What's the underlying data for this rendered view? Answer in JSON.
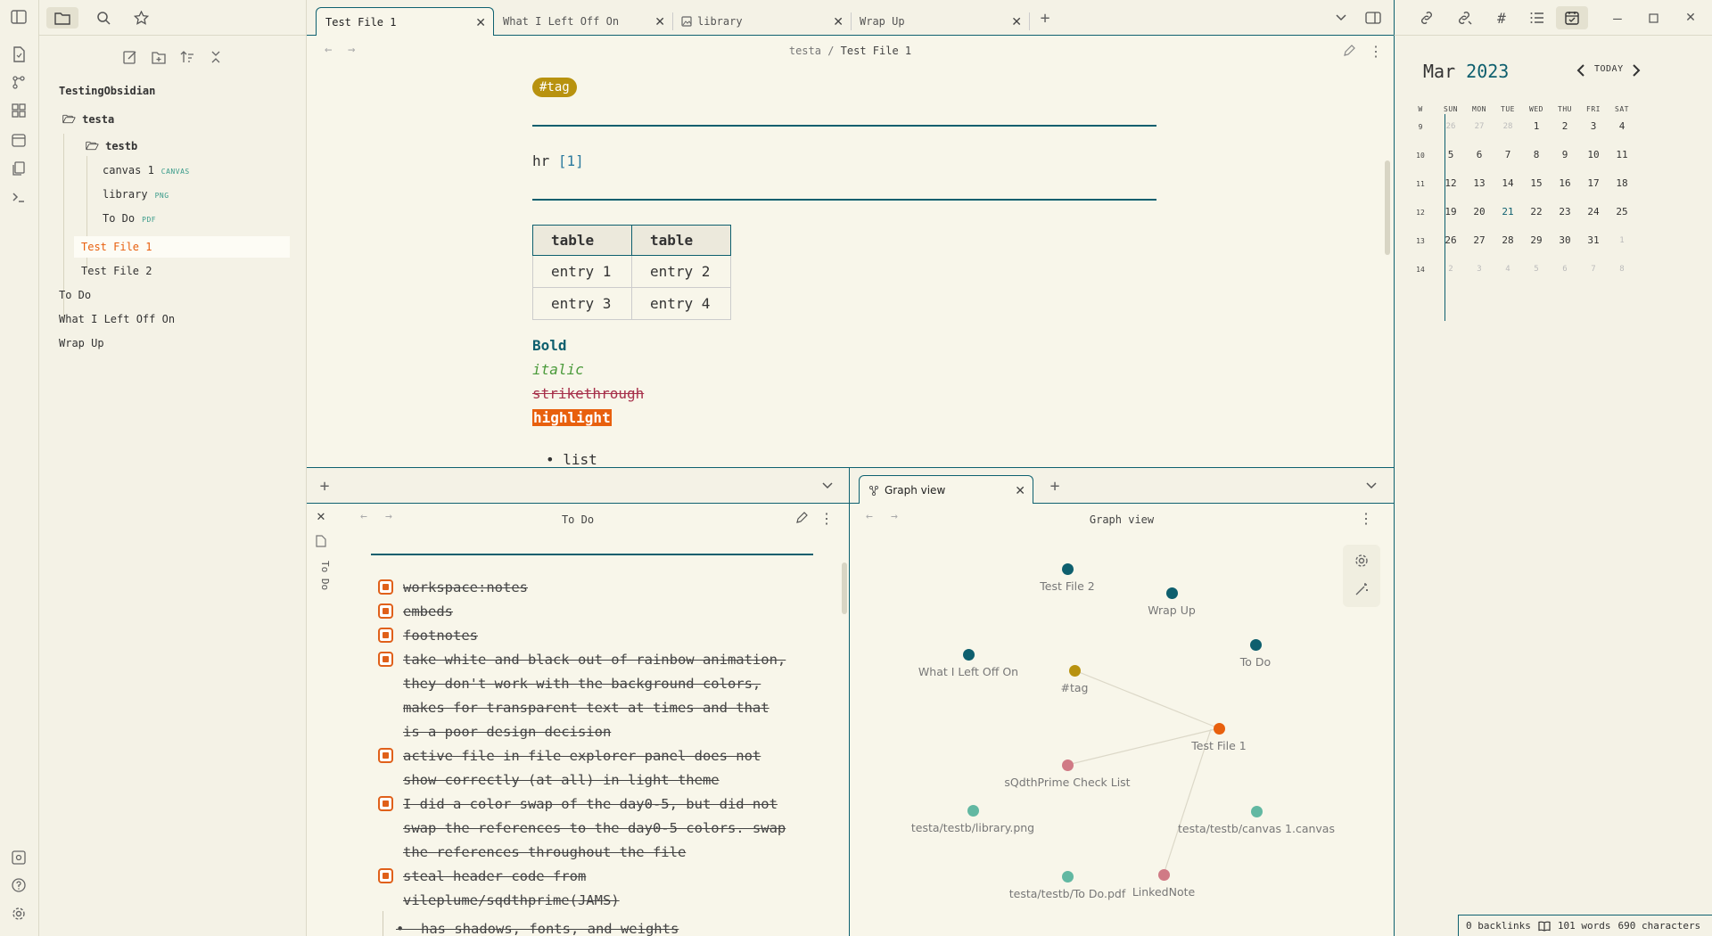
{
  "left_tabs": {
    "files": "Files",
    "search": "Search",
    "bookmarks": "Bookmarks"
  },
  "file_tree": {
    "vault": "TestingObsidian",
    "folder_a": "testa",
    "folder_b": "testb",
    "items": [
      {
        "name": "canvas 1",
        "ext": "CANVAS"
      },
      {
        "name": "library",
        "ext": "PNG"
      },
      {
        "name": "To Do",
        "ext": "PDF"
      }
    ],
    "test1": "Test File 1",
    "test2": "Test File 2",
    "root": [
      "To Do",
      "What I Left Off On",
      "Wrap Up"
    ]
  },
  "tabs": [
    "Test File 1",
    "What I Left Off On",
    "library",
    "Wrap Up"
  ],
  "editor": {
    "breadcrumb_folder": "testa",
    "breadcrumb_sep": "/",
    "breadcrumb_file": "Test File 1",
    "tag": "#tag",
    "hr_text": "hr",
    "footnote": "[1]",
    "table": {
      "headers": [
        "table",
        "table"
      ],
      "rows": [
        [
          "entry 1",
          "entry 2"
        ],
        [
          "entry 3",
          "entry 4"
        ]
      ]
    },
    "bold": "Bold",
    "italic": "italic",
    "strike": "strikethrough",
    "highlight": "highlight",
    "list_item": "list"
  },
  "calendar": {
    "month": "Mar",
    "year": "2023",
    "today_label": "TODAY",
    "headers": [
      "W",
      "SUN",
      "MON",
      "TUE",
      "WED",
      "THU",
      "FRI",
      "SAT"
    ],
    "rows": [
      [
        "9",
        "26",
        "27",
        "28",
        "1",
        "2",
        "3",
        "4"
      ],
      [
        "10",
        "5",
        "6",
        "7",
        "8",
        "9",
        "10",
        "11"
      ],
      [
        "11",
        "12",
        "13",
        "14",
        "15",
        "16",
        "17",
        "18"
      ],
      [
        "12",
        "19",
        "20",
        "21",
        "22",
        "23",
        "24",
        "25"
      ],
      [
        "13",
        "26",
        "27",
        "28",
        "29",
        "30",
        "31",
        "1"
      ],
      [
        "14",
        "2",
        "3",
        "4",
        "5",
        "6",
        "7",
        "8"
      ]
    ],
    "today": "21"
  },
  "bottom_left": {
    "title": "To Do",
    "side_label": "To Do",
    "todos": [
      [
        "workspace:notes"
      ],
      [
        "embeds"
      ],
      [
        "footnotes"
      ],
      [
        "take white and black out of rainbow animation,",
        "they don't work with the background colors,",
        "makes for transparent text at times and that",
        "is a poor design decision"
      ],
      [
        "active file in file explorer panel does not",
        "show correctly (at all) in light theme"
      ],
      [
        "I did a color swap of the day0-5, but did not",
        "swap the references to the day0-5 colors. swap",
        "the references throughout the file"
      ],
      [
        "steal header code from",
        "vileplume/sqdthprime(JAMS)"
      ]
    ],
    "subitem": "has shadows, fonts, and weights"
  },
  "graph": {
    "tab": "Graph view",
    "title": "Graph view",
    "nodes": [
      {
        "label": "Test File 2",
        "color": "#0e5f6e"
      },
      {
        "label": "Wrap Up",
        "color": "#0e5f6e"
      },
      {
        "label": "What I Left Off On",
        "color": "#0e5f6e"
      },
      {
        "label": "To Do",
        "color": "#0e5f6e"
      },
      {
        "label": "#tag",
        "color": "#b8920f"
      },
      {
        "label": "Test File 1",
        "color": "#e8600e"
      },
      {
        "label": "sQdthPrime Check List",
        "color": "#d07a85"
      },
      {
        "label": "testa/testb/library.png",
        "color": "#62b8a2"
      },
      {
        "label": "testa/testb/canvas 1.canvas",
        "color": "#62b8a2"
      },
      {
        "label": "testa/testb/To Do.pdf",
        "color": "#62b8a2"
      },
      {
        "label": "LinkedNote",
        "color": "#d07a85"
      }
    ]
  },
  "status": {
    "backlinks": "0 backlinks",
    "words": "101 words",
    "chars": "690 characters"
  }
}
